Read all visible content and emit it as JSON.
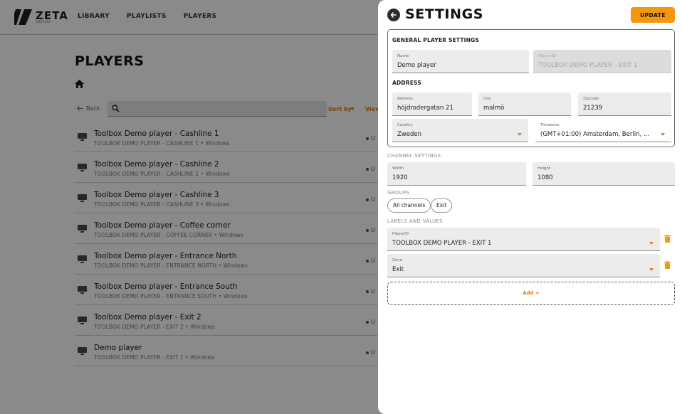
{
  "app": {
    "logo_text": "ZETA",
    "logo_sub": "DISPLAY",
    "nav": [
      "LIBRARY",
      "PLAYLISTS",
      "PLAYERS"
    ],
    "page_title": "PLAYERS",
    "back_label": "Back",
    "search": {
      "value": "",
      "placeholder": ""
    },
    "sort_label": "Sort by",
    "view_label": "View",
    "status_text": "U",
    "players": [
      {
        "name": "Toolbox Demo player - Cashline 1",
        "sub": "TOOLBOX DEMO PLAYER - CASHLINE 1 • Windows"
      },
      {
        "name": "Toolbox Demo player - Cashline 2",
        "sub": "TOOLBOX DEMO PLAYER - CASHLINE 2 • Windows"
      },
      {
        "name": "Toolbox Demo player - Cashline 3",
        "sub": "TOOLBOX DEMO PLAYER - CASHLINE 3 • Windows"
      },
      {
        "name": "Toolbox Demo player - Coffee corner",
        "sub": "TOOLBOX DEMO PLAYER - COFFEE CORNER • Windows"
      },
      {
        "name": "Toolbox Demo player - Entrance North",
        "sub": "TOOLBOX DEMO PLAYER - ENTRANCE NORTH • Windows"
      },
      {
        "name": "Toolbox Demo player - Entrance South",
        "sub": "TOOLBOX DEMO PLAYER - ENTRANCE SOUTH • Windows"
      },
      {
        "name": "Toolbox Demo player - Exit 2",
        "sub": "TOOLBOX DEMO PLAYER - EXIT 2 • Windows"
      },
      {
        "name": "Demo player",
        "sub": "TOOLBOX DEMO PLAYER - EXIT 1 • Windows"
      }
    ]
  },
  "settings": {
    "title": "SETTINGS",
    "update_label": "UPDATE",
    "general": {
      "heading": "GENERAL PLAYER SETTINGS",
      "name": {
        "label": "Name",
        "value": "Demo player"
      },
      "player_id": {
        "label": "Player ID",
        "value": "TOOLBOX DEMO PLAYER - EXIT 1"
      }
    },
    "address": {
      "heading": "ADDRESS",
      "address": {
        "label": "Address",
        "value": "höjdrodergatan 21"
      },
      "city": {
        "label": "City",
        "value": "malmö"
      },
      "zipcode": {
        "label": "Zipcode",
        "value": "21239"
      },
      "country": {
        "label": "Country",
        "value": "Zweden"
      },
      "timezone": {
        "label": "Timezone",
        "value": "(GMT+01:00) Amsterdam, Berlin, ..."
      }
    },
    "channel": {
      "heading": "CHANNEL SETTINGS",
      "width": {
        "label": "Width",
        "value": "1920"
      },
      "height": {
        "label": "Height",
        "value": "1080"
      }
    },
    "groups": {
      "heading": "GROUPS",
      "chips": [
        "All channels",
        "Exit"
      ]
    },
    "labels": {
      "heading": "LABELS AND VALUES",
      "items": [
        {
          "label": "PlayerID",
          "value": "TOOLBOX DEMO PLAYER - EXIT 1"
        },
        {
          "label": "Zone",
          "value": "Exit"
        }
      ],
      "add_label": "Add +"
    }
  },
  "colors": {
    "accent": "#f39710",
    "accent_text": "#d9820c",
    "status_dot": "#2f4fd8",
    "overlay": "rgba(0,0,0,0.46)"
  }
}
